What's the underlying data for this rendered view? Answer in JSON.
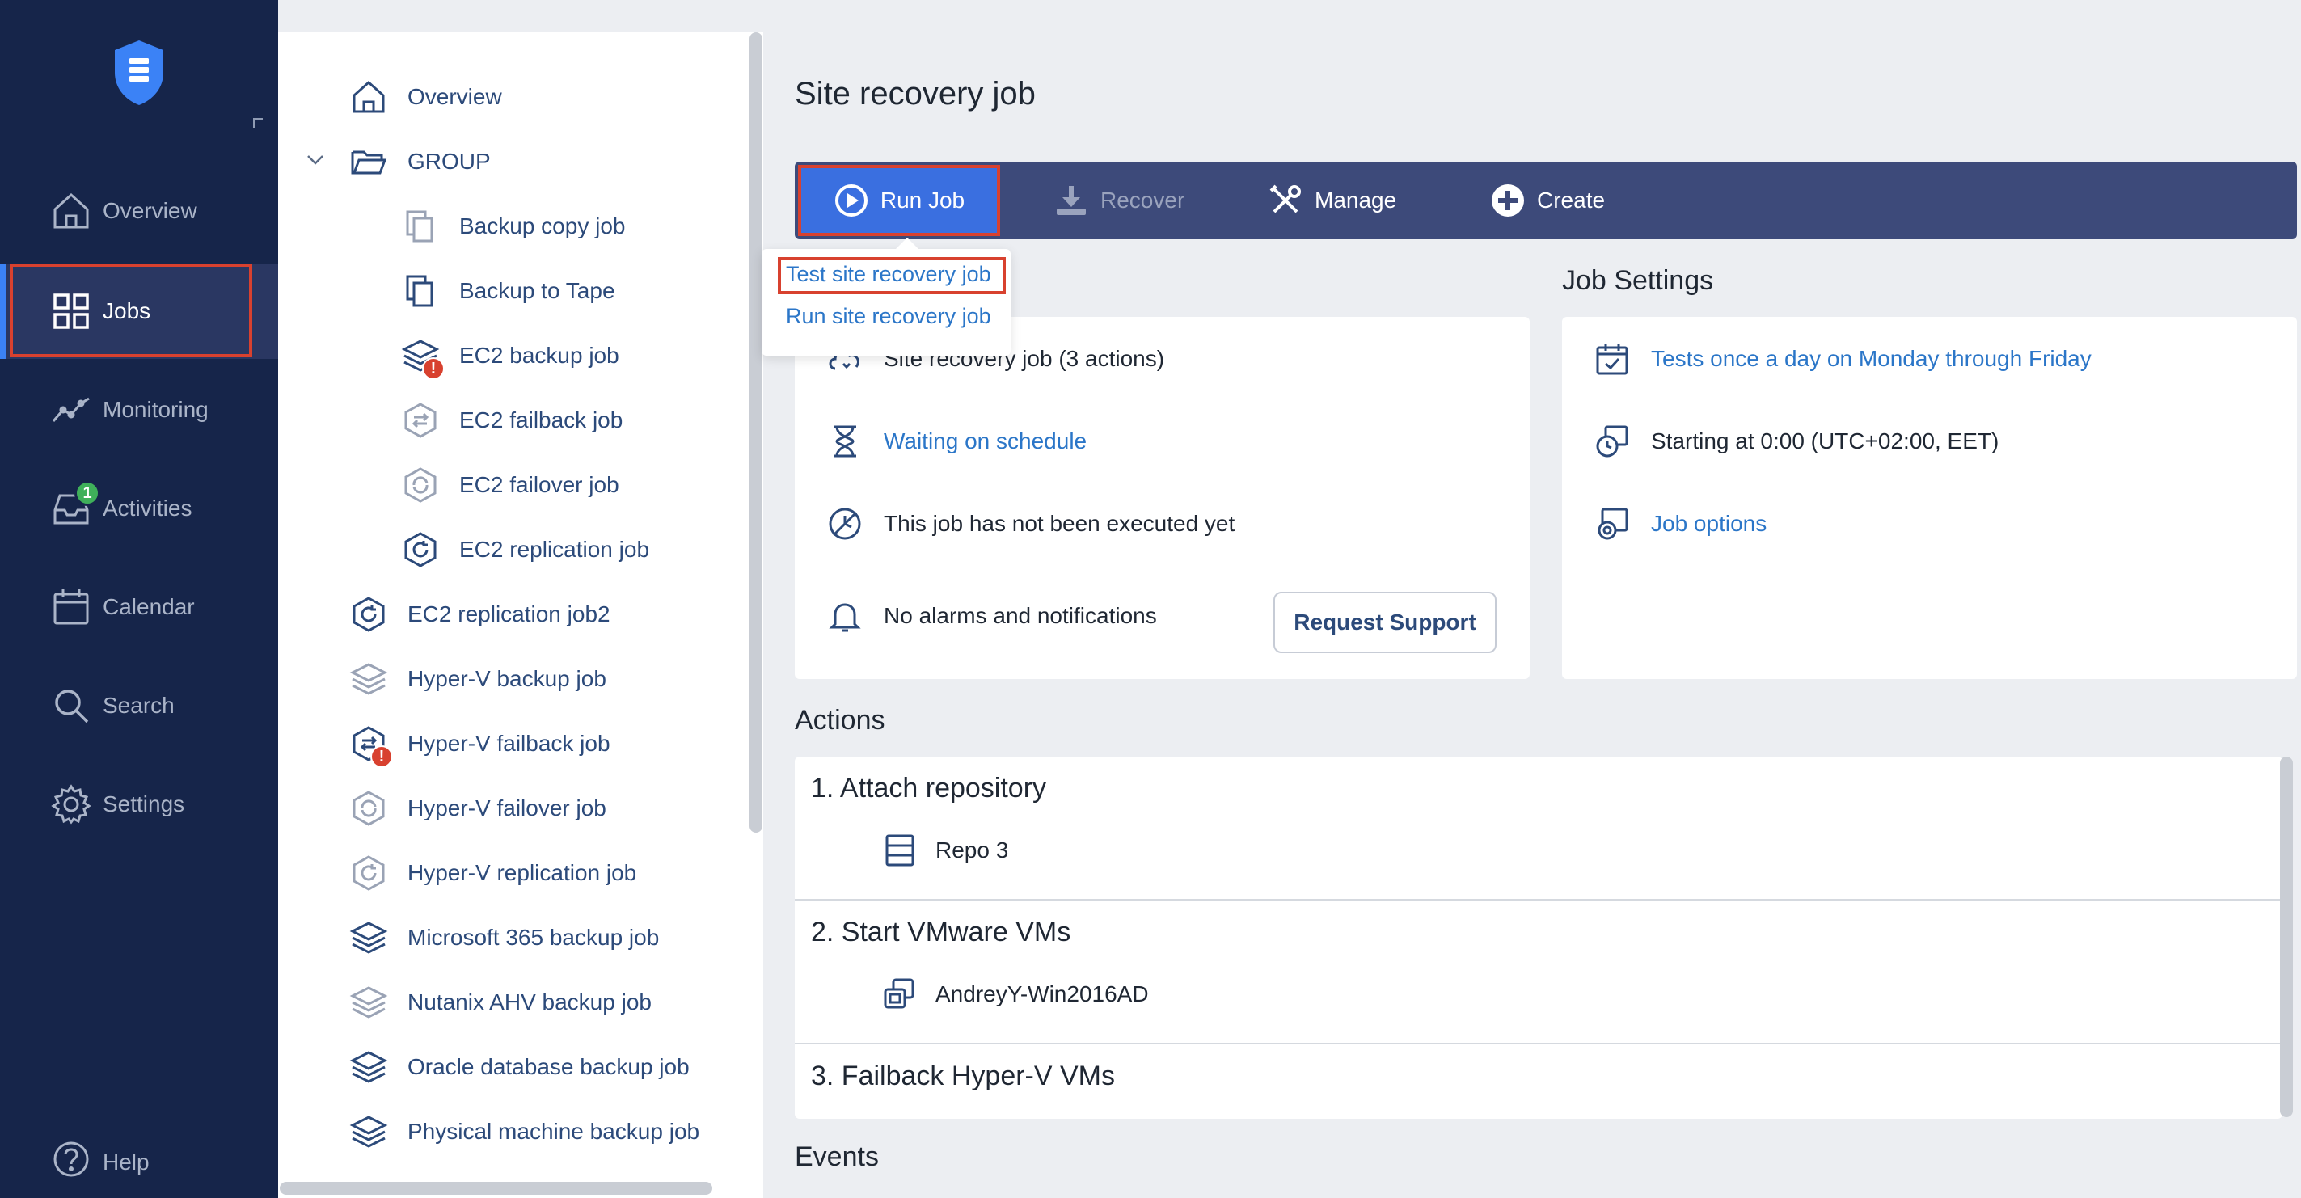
{
  "sidebar": {
    "items": [
      {
        "label": "Overview",
        "icon": "home-icon"
      },
      {
        "label": "Jobs",
        "icon": "grid-icon"
      },
      {
        "label": "Monitoring",
        "icon": "chart-line-icon"
      },
      {
        "label": "Activities",
        "icon": "inbox-icon",
        "badge": "1"
      },
      {
        "label": "Calendar",
        "icon": "calendar-icon"
      },
      {
        "label": "Search",
        "icon": "search-icon"
      },
      {
        "label": "Settings",
        "icon": "gear-icon"
      }
    ],
    "help": "Help",
    "accent": "#3b82f6",
    "bg": "#16254a"
  },
  "tree": {
    "items": [
      {
        "label": "Overview"
      },
      {
        "label": "GROUP"
      },
      {
        "label": "Backup copy job"
      },
      {
        "label": "Backup to Tape"
      },
      {
        "label": "EC2 backup job",
        "error": "!"
      },
      {
        "label": "EC2 failback job"
      },
      {
        "label": "EC2 failover job"
      },
      {
        "label": "EC2 replication job"
      },
      {
        "label": "EC2 replication job2"
      },
      {
        "label": "Hyper-V backup job"
      },
      {
        "label": "Hyper-V failback job",
        "error": "!"
      },
      {
        "label": "Hyper-V failover job"
      },
      {
        "label": "Hyper-V replication job"
      },
      {
        "label": "Microsoft 365 backup job"
      },
      {
        "label": "Nutanix AHV backup job"
      },
      {
        "label": "Oracle database backup job"
      },
      {
        "label": "Physical machine backup job"
      }
    ]
  },
  "main": {
    "title": "Site recovery job",
    "toolbar": {
      "run": "Run Job",
      "recover": "Recover",
      "manage": "Manage",
      "create": "Create"
    },
    "dropdown": {
      "test": "Test site recovery job",
      "run": "Run site recovery job"
    },
    "summary": {
      "job_type": "Site recovery job (3 actions)",
      "status": "Waiting on schedule",
      "last_run": "This job has not been executed yet",
      "alarms": "No alarms and notifications",
      "support_button": "Request Support"
    },
    "settings": {
      "title": "Job Settings",
      "schedule": "Tests once a day on Monday through Friday",
      "start": "Starting at 0:00 (UTC+02:00, EET)",
      "options": "Job options"
    },
    "actions": {
      "title": "Actions",
      "items": [
        {
          "title": "1. Attach repository",
          "sub": "Repo 3"
        },
        {
          "title": "2. Start VMware VMs",
          "sub": "AndreyY-Win2016AD"
        },
        {
          "title": "3. Failback Hyper-V VMs"
        }
      ]
    },
    "events_title": "Events",
    "colors": {
      "link": "#2b76c8",
      "toolbar": "#3d4a7a",
      "run_button": "#3a6fe0",
      "highlight": "#d8412f"
    }
  }
}
